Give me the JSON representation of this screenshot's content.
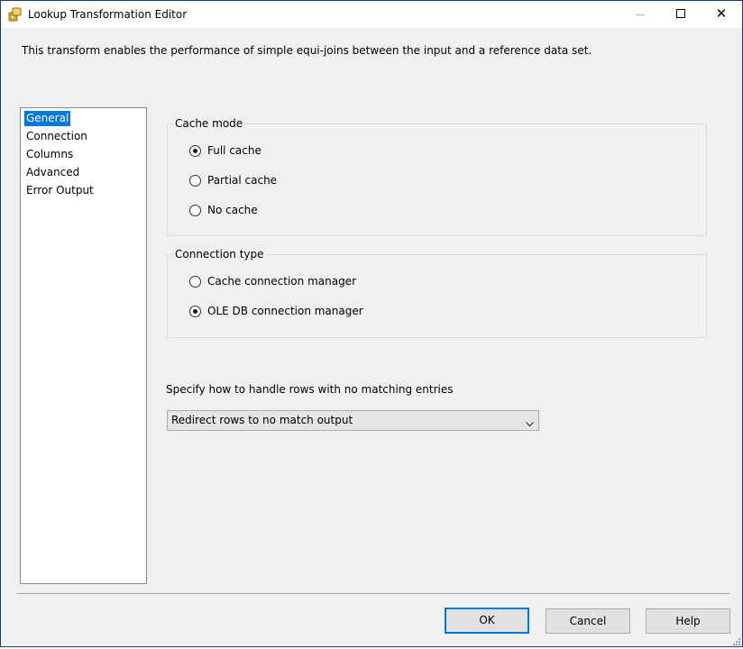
{
  "window": {
    "title": "Lookup Transformation Editor",
    "controls": {
      "minimize": "minimize",
      "maximize": "maximize",
      "close": "✕"
    }
  },
  "description": "This transform enables the performance of simple equi-joins between the input and a reference data set.",
  "nav": {
    "items": [
      {
        "label": "General",
        "selected": true
      },
      {
        "label": "Connection",
        "selected": false
      },
      {
        "label": "Columns",
        "selected": false
      },
      {
        "label": "Advanced",
        "selected": false
      },
      {
        "label": "Error Output",
        "selected": false
      }
    ]
  },
  "cache_mode": {
    "legend": "Cache mode",
    "options": [
      {
        "label": "Full cache",
        "checked": true
      },
      {
        "label": "Partial cache",
        "checked": false
      },
      {
        "label": "No cache",
        "checked": false
      }
    ]
  },
  "connection_type": {
    "legend": "Connection type",
    "options": [
      {
        "label": "Cache connection manager",
        "checked": false
      },
      {
        "label": "OLE DB connection manager",
        "checked": true
      }
    ]
  },
  "no_match": {
    "label": "Specify how to handle rows with no matching entries",
    "selected_value": "Redirect rows to no match output"
  },
  "buttons": {
    "ok": "OK",
    "cancel": "Cancel",
    "help": "Help"
  },
  "colors": {
    "selection": "#0078d7",
    "window_border": "#1a3a80",
    "dialog_bg": "#f0f0f0"
  },
  "icons": [
    "app-icon",
    "minimize-icon",
    "maximize-icon",
    "close-icon",
    "chevron-down-icon",
    "resize-grip-icon"
  ]
}
